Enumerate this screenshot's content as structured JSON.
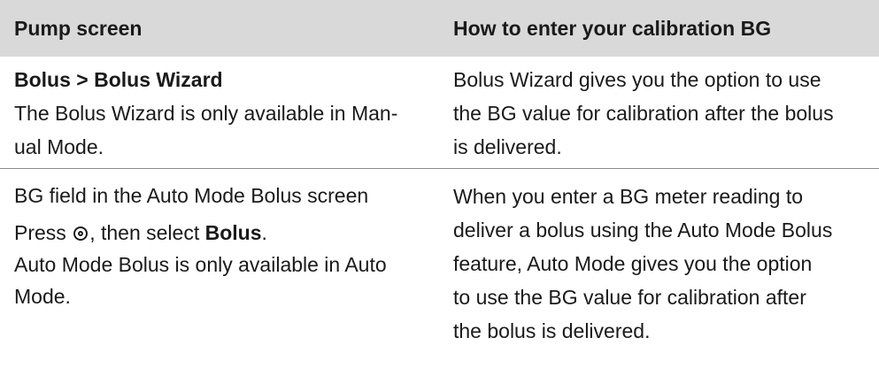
{
  "header": {
    "col1": "Pump screen",
    "col2": "How to enter your calibration BG"
  },
  "rows": [
    {
      "screen_title": "Bolus > Bolus Wizard",
      "screen_note_lines": [
        "The Bolus Wizard is only available in Man-",
        "ual Mode."
      ],
      "instructions_lines": [
        "Bolus Wizard gives you the option to use",
        "the BG value for calibration after the bolus",
        "is delivered."
      ]
    },
    {
      "screen_title": "BG field in the Auto Mode Bolus screen",
      "press_prefix": "Press",
      "press_middle": ", then select",
      "press_bold": "Bolus",
      "press_suffix": ".",
      "button_icon": "select-button-icon",
      "screen_note_lines": [
        "Auto Mode Bolus is only available in Auto",
        "Mode."
      ],
      "instructions_lines": [
        "When you enter a BG meter reading to",
        "deliver a bolus using the Auto Mode Bolus",
        "feature, Auto Mode gives you the option",
        "to use the BG value for calibration after",
        "the bolus is delivered."
      ]
    }
  ]
}
